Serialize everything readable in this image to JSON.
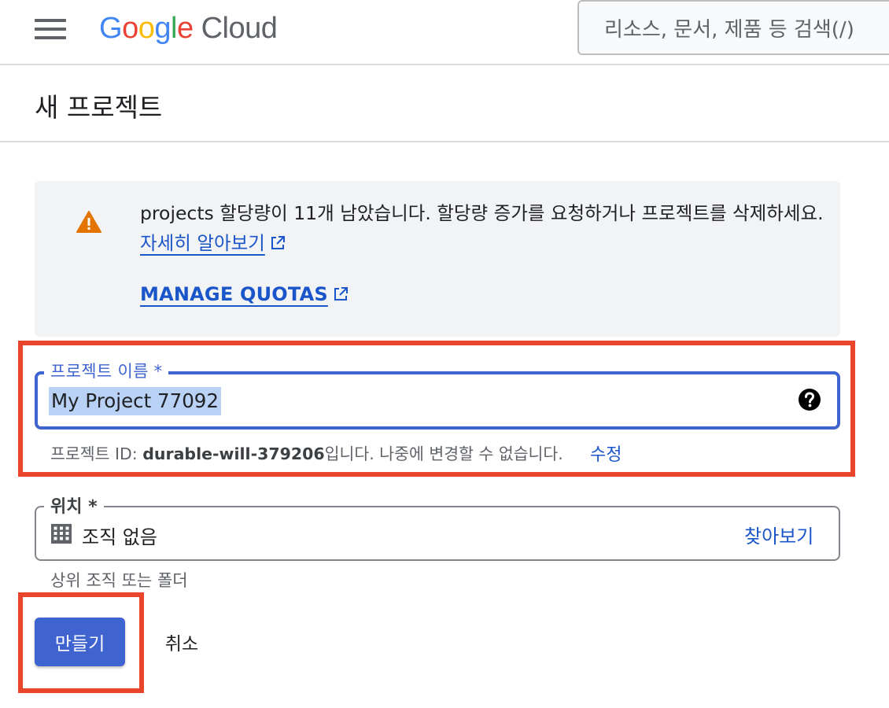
{
  "topbar": {
    "logo": {
      "letters": [
        "G",
        "o",
        "o",
        "g",
        "l",
        "e"
      ],
      "product": "Cloud"
    },
    "search_placeholder": "리소스, 문서, 제품 등 검색(/)"
  },
  "page": {
    "title": "새 프로젝트"
  },
  "notice": {
    "message": "projects 할당량이 11개 남았습니다. 할당량 증가를 요청하거나 프로젝트를 삭제하세요.",
    "learn_more_link": "자세히 알아보기",
    "manage_quotas_link": "MANAGE QUOTAS"
  },
  "project_name_field": {
    "label": "프로젝트 이름 *",
    "value": "My Project 77092",
    "hint_prefix": "프로젝트 ID: ",
    "project_id": "durable-will-379206",
    "hint_suffix": "입니다. 나중에 변경할 수 없습니다.",
    "edit_link": "수정"
  },
  "location_field": {
    "label": "위치 *",
    "value": "조직 없음",
    "browse_link": "찾아보기",
    "hint": "상위 조직 또는 폴더"
  },
  "actions": {
    "create": "만들기",
    "cancel": "취소"
  },
  "colors": {
    "accent": "#3f63cf",
    "link": "#1a56c9",
    "warning": "#e37400",
    "highlight_box": "#e8452a"
  }
}
